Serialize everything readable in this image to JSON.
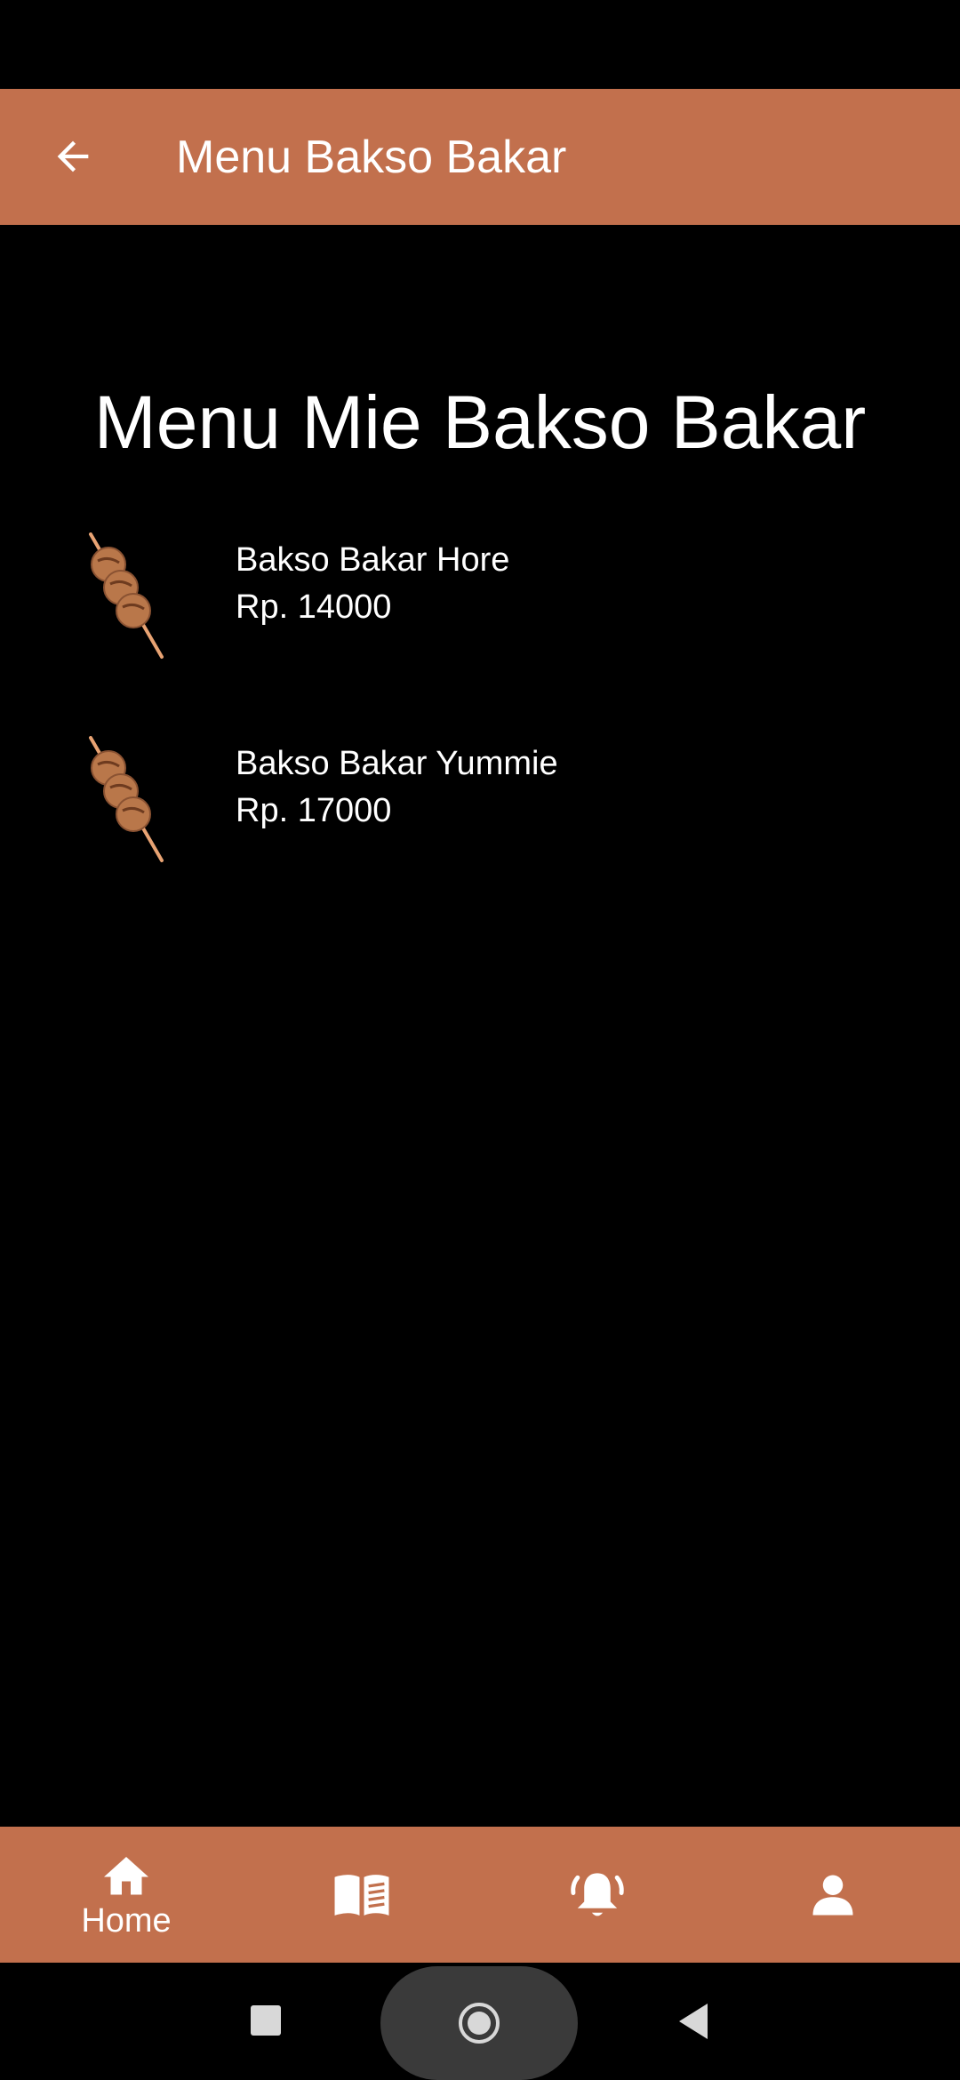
{
  "app_bar": {
    "title": "Menu Bakso Bakar",
    "back_icon": "arrow-back-icon"
  },
  "page": {
    "heading": "Menu Mie Bakso Bakar"
  },
  "menu": {
    "items": [
      {
        "name": "Bakso Bakar Hore",
        "price": "Rp. 14000",
        "icon": "meatball-skewer-icon"
      },
      {
        "name": "Bakso Bakar Yummie",
        "price": "Rp. 17000",
        "icon": "meatball-skewer-icon"
      }
    ]
  },
  "bottom_nav": {
    "items": [
      {
        "label": "Home",
        "icon": "home-icon",
        "selected": true
      },
      {
        "label": "",
        "icon": "menu-book-icon",
        "selected": false
      },
      {
        "label": "",
        "icon": "notification-bell-icon",
        "selected": false
      },
      {
        "label": "",
        "icon": "person-icon",
        "selected": false
      }
    ]
  },
  "colors": {
    "accent": "#c2704d",
    "background": "#000000",
    "text": "#ffffff"
  }
}
